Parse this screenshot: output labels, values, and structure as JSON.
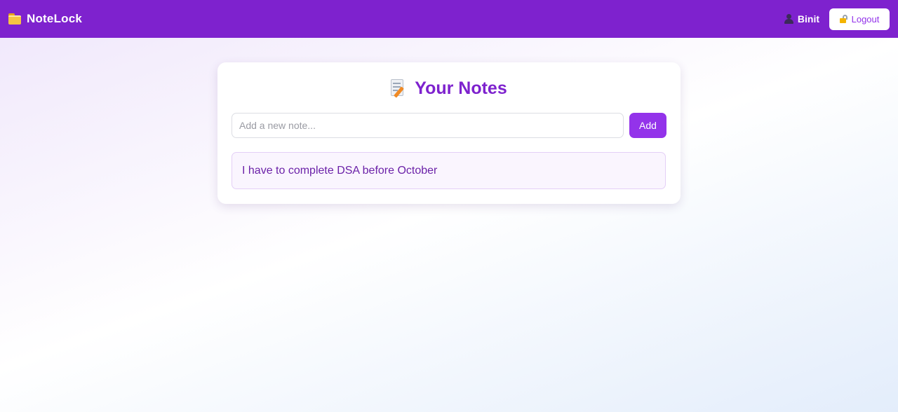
{
  "navbar": {
    "brand_icon": "folder-icon",
    "brand_name": "NoteLock",
    "user_icon": "user-icon",
    "user_name": "Binit",
    "logout_icon": "lock-icon",
    "logout_label": "Logout"
  },
  "main": {
    "title_icon": "memo-icon",
    "title": "Your Notes",
    "input": {
      "placeholder": "Add a new note...",
      "value": ""
    },
    "add_label": "Add",
    "notes": [
      {
        "text": "I have to complete DSA before October"
      }
    ]
  },
  "colors": {
    "accent": "#7e22ce",
    "button": "#9333ea",
    "note_bg": "#faf5fe",
    "note_text": "#6b21a8"
  }
}
